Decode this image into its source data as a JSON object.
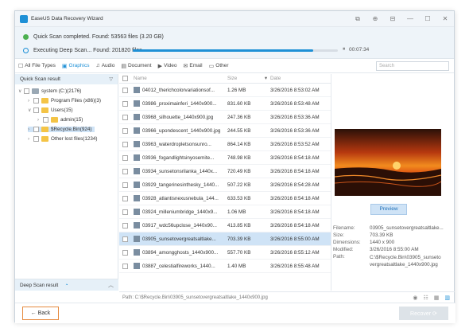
{
  "app": {
    "title": "EaseUS Data Recovery Wizard",
    "window_icons": [
      "⧉",
      "⊕",
      "⊟",
      "—",
      "☐",
      "✕"
    ]
  },
  "status": {
    "quick_scan": "Quick Scan completed.  Found: 53563 files (3.20 GB)",
    "deep_scan": "Executing Deep Scan... Found: 201820 files",
    "progress_fraction": 0.88,
    "pause_icon": "⏸",
    "timer": "00:07:34"
  },
  "tabs": [
    {
      "label": "All File Types",
      "icon": "☐",
      "icon_name": "all-files-icon"
    },
    {
      "label": "Graphics",
      "icon": "▣",
      "icon_name": "graphics-icon",
      "active": true
    },
    {
      "label": "Audio",
      "icon": "♫",
      "icon_name": "audio-icon"
    },
    {
      "label": "Document",
      "icon": "▤",
      "icon_name": "document-icon"
    },
    {
      "label": "Video",
      "icon": "▶",
      "icon_name": "video-icon"
    },
    {
      "label": "Email",
      "icon": "✉",
      "icon_name": "email-icon"
    },
    {
      "label": "Other",
      "icon": "▭",
      "icon_name": "other-icon"
    }
  ],
  "search": {
    "placeholder": "Search"
  },
  "sidebar": {
    "header": "Quick Scan result",
    "tree": [
      {
        "label": "system (C:)(2176)",
        "type": "drive"
      },
      {
        "label": "Program Files (x86)(3)",
        "type": "folder"
      },
      {
        "label": "Users(15)",
        "type": "folder"
      },
      {
        "label": "admin(15)",
        "type": "folder"
      },
      {
        "label": "$Recycle.Bin(924)",
        "type": "folder",
        "selected": true
      },
      {
        "label": "Other lost files(1234)",
        "type": "folder"
      }
    ],
    "deep_header": "Deep Scan result"
  },
  "list": {
    "headers": {
      "name": "Name",
      "size": "Size",
      "date": "Date"
    },
    "rows": [
      {
        "name": "04012_therichcolorvariationsof...",
        "size": "1.26 MB",
        "date": "3/26/2016 8:53:02 AM"
      },
      {
        "name": "03986_proximainferi_1440x900...",
        "size": "831.60 KB",
        "date": "3/26/2016 8:53:48 AM"
      },
      {
        "name": "03968_silhouette_1440x900.jpg",
        "size": "247.36 KB",
        "date": "3/26/2016 8:53:36 AM"
      },
      {
        "name": "03966_upondescent_1440x900.jpg",
        "size": "244.55 KB",
        "date": "3/26/2016 8:53:36 AM"
      },
      {
        "name": "03963_waterdropletsonsunro...",
        "size": "864.14 KB",
        "date": "3/26/2016 8:53:52 AM"
      },
      {
        "name": "03936_fogandlightsinyosemite...",
        "size": "748.98 KB",
        "date": "3/26/2016 8:54:18 AM"
      },
      {
        "name": "03934_sunsetonsrilanka_1440x...",
        "size": "720.49 KB",
        "date": "3/26/2016 8:54:18 AM"
      },
      {
        "name": "03929_tangerinesinthesky_1440...",
        "size": "507.22 KB",
        "date": "3/26/2016 8:54:28 AM"
      },
      {
        "name": "03928_atlantisnexusnebula_144...",
        "size": "633.53 KB",
        "date": "3/26/2016 8:54:18 AM"
      },
      {
        "name": "03924_milleniumbridge_1440x9...",
        "size": "1.06 MB",
        "date": "3/26/2016 8:54:18 AM"
      },
      {
        "name": "03917_wdc56upclose_1440x90...",
        "size": "413.85 KB",
        "date": "3/26/2016 8:54:18 AM"
      },
      {
        "name": "03905_sunsetovergreatsaltlake...",
        "size": "703.39 KB",
        "date": "3/26/2016 8:55:00 AM",
        "selected": true
      },
      {
        "name": "03894_amongghosts_1440x900...",
        "size": "557.70 KB",
        "date": "3/26/2016 8:55:12 AM"
      },
      {
        "name": "03887_celestialfireworks_1440...",
        "size": "1.40 MB",
        "date": "3/26/2016 8:55:48 AM"
      }
    ]
  },
  "pathbar": {
    "text": "Path:   C:\\$Recycle.Bin\\03905_sunsetovergreatsaltlake_1440x900.jpg",
    "icons": [
      "◉",
      "☷",
      "▦",
      "▥"
    ]
  },
  "preview": {
    "button": "Preview",
    "filename_label": "Filename:",
    "filename": "03905_sunsetovergreatsaltlake...",
    "size_label": "Size:",
    "size": "703.39 KB",
    "dimensions_label": "Dimensions:",
    "dimensions": "1440 x 900",
    "modified_label": "Modified:",
    "modified": "3/26/2016 8:55:00 AM",
    "path_label": "Path:",
    "path": "C:\\$Recycle.Bin\\03905_sunseto vergreatsaltlake_1440x900.jpg"
  },
  "footer": {
    "back": "← Back",
    "recover": "Recover ⟳"
  },
  "colors": {
    "accent": "#1e90d6",
    "back_border": "#e68a3f",
    "selected_row": "#cfe3f6"
  }
}
